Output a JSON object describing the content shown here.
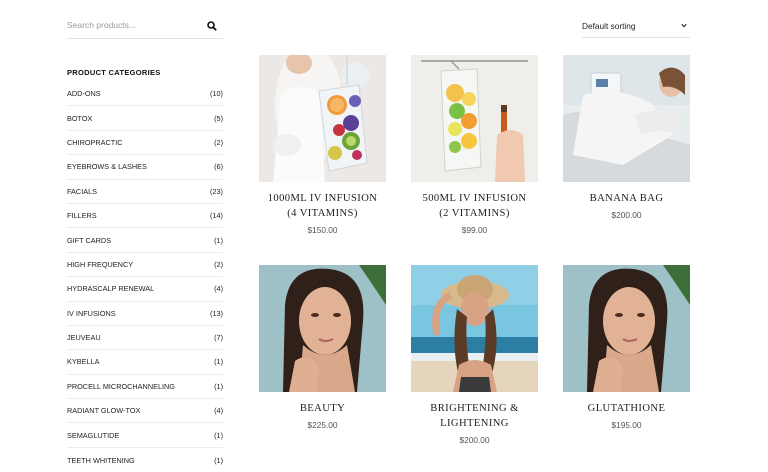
{
  "search": {
    "placeholder": "Search products..."
  },
  "sidebar": {
    "heading": "PRODUCT CATEGORIES",
    "categories": [
      {
        "name": "ADD-ONS",
        "count": "(10)"
      },
      {
        "name": "BOTOX",
        "count": "(5)"
      },
      {
        "name": "CHIROPRACTIC",
        "count": "(2)"
      },
      {
        "name": "EYEBROWS & LASHES",
        "count": "(6)"
      },
      {
        "name": "FACIALS",
        "count": "(23)"
      },
      {
        "name": "FILLERS",
        "count": "(14)"
      },
      {
        "name": "GIFT CARDS",
        "count": "(1)"
      },
      {
        "name": "HIGH FREQUENCY",
        "count": "(2)"
      },
      {
        "name": "HYDRASCALP RENEWAL",
        "count": "(4)"
      },
      {
        "name": "IV INFUSIONS",
        "count": "(13)"
      },
      {
        "name": "JEUVEAU",
        "count": "(7)"
      },
      {
        "name": "KYBELLA",
        "count": "(1)"
      },
      {
        "name": "PROCELL MICROCHANNELING",
        "count": "(1)"
      },
      {
        "name": "RADIANT GLOW-TOX",
        "count": "(4)"
      },
      {
        "name": "SEMAGLUTIDE",
        "count": "(1)"
      },
      {
        "name": "TEETH WHITENING",
        "count": "(1)"
      }
    ]
  },
  "sorting": {
    "selected": "Default sorting"
  },
  "products": [
    {
      "name": "1000ML IV INFUSION (4 VITAMINS)",
      "price": "$150.00",
      "image": "iv-bag-fruit-photo"
    },
    {
      "name": "500ML IV INFUSION (2 VITAMINS)",
      "price": "$99.00",
      "image": "iv-bag-citrus-photo"
    },
    {
      "name": "BANANA BAG",
      "price": "$200.00",
      "image": "woman-reclining-clinic-photo"
    },
    {
      "name": "BEAUTY",
      "price": "$225.00",
      "image": "woman-portrait-photo"
    },
    {
      "name": "BRIGHTENING & LIGHTENING",
      "price": "$200.00",
      "image": "woman-beach-hat-photo"
    },
    {
      "name": "GLUTATHIONE",
      "price": "$195.00",
      "image": "woman-portrait-photo"
    }
  ]
}
